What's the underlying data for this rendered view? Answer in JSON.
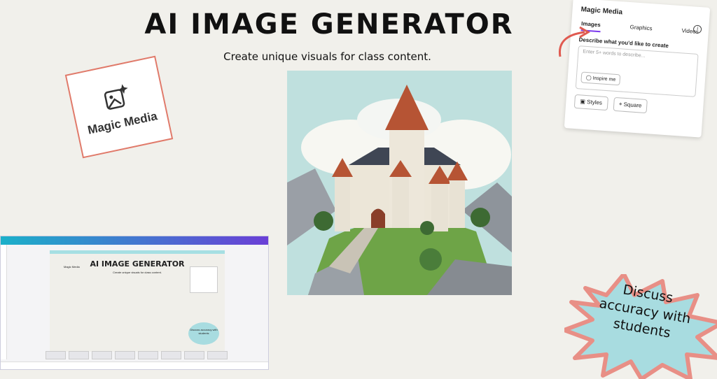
{
  "title": "AI IMAGE GENERATOR",
  "subtitle": "Create unique visuals for class content.",
  "tile": {
    "label": "Magic Media",
    "icon": "magic-image-icon"
  },
  "panel": {
    "heading": "Magic Media",
    "tabs": [
      "Images",
      "Graphics",
      "Videos"
    ],
    "active_tab": "Images",
    "describe_label": "Describe what you'd like to create",
    "placeholder": "Enter 5+ words to describe...",
    "inspire_label": "Inspire me",
    "styles_label": "Styles",
    "square_label": "Square"
  },
  "editor": {
    "title": "AI IMAGE GENERATOR",
    "subtitle": "Create unique visuals for class content.",
    "tile_label": "Magic Media",
    "burst_text": "Discuss accuracy with students"
  },
  "burst": {
    "text": "Discuss accuracy with students"
  },
  "colors": {
    "accent": "#7c3aed",
    "tile_border": "#e07a6a",
    "burst_fill": "#a8dce0",
    "burst_outline": "#e88f86",
    "arrow": "#e05a50"
  }
}
